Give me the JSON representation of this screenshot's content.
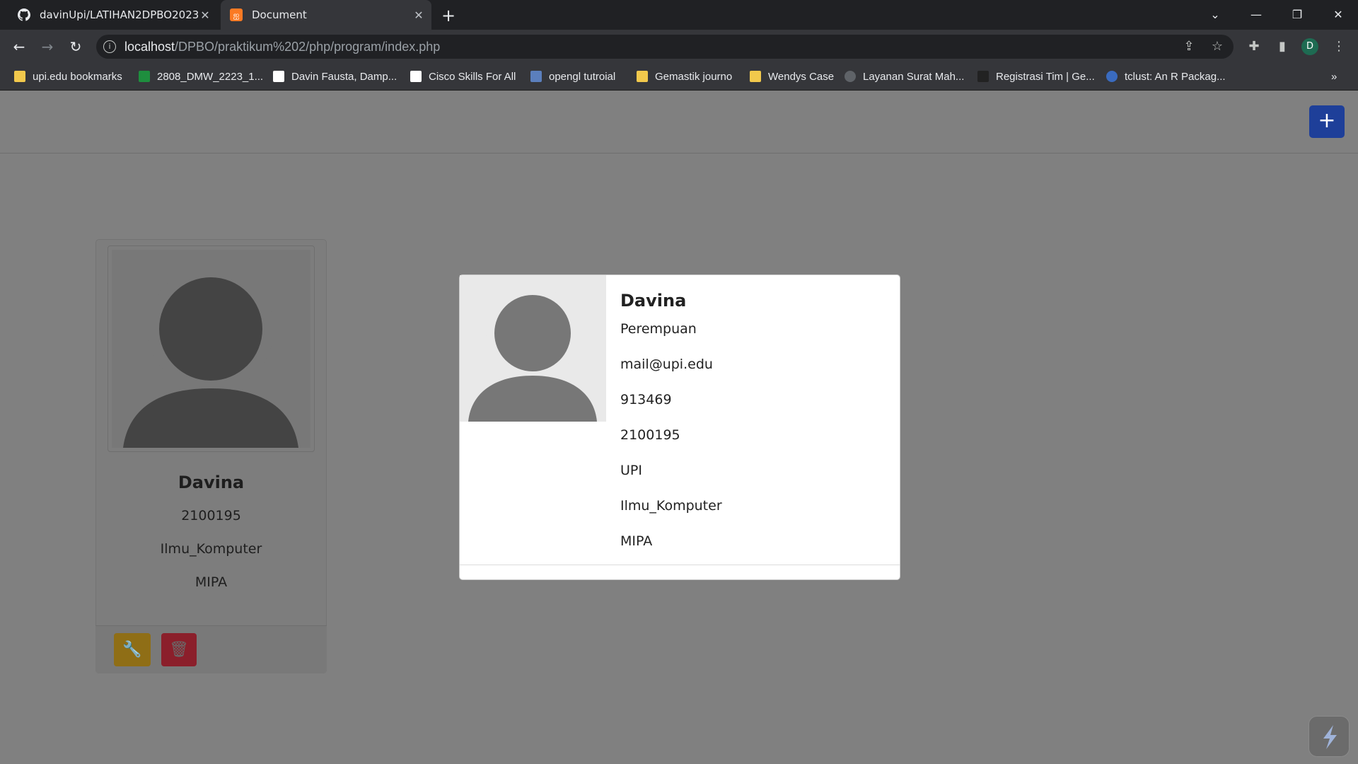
{
  "browser": {
    "tabs": [
      {
        "title": "davinUpi/LATIHAN2DPBO2023: \"",
        "active": false
      },
      {
        "title": "Document",
        "active": true
      }
    ],
    "new_tab_label": "+",
    "url_host": "localhost",
    "url_path": "/DPBO/praktikum%202/php/program/index.php",
    "profile_initial": "D",
    "bookmarks": [
      {
        "label": "upi.edu bookmarks",
        "icon": "folder-icon",
        "color": "#f2c94c"
      },
      {
        "label": "2808_DMW_2223_1...",
        "icon": "sheets-icon",
        "color": "#1e8e3e"
      },
      {
        "label": "Davin Fausta, Damp...",
        "icon": "pkp-icon",
        "color": "#ffffff"
      },
      {
        "label": "Cisco Skills For All",
        "icon": "cisco-icon",
        "color": "#ffffff"
      },
      {
        "label": "opengl tutroial",
        "icon": "opengl-icon",
        "color": "#5b7fbd"
      },
      {
        "label": "Gemastik journo",
        "icon": "folder-icon",
        "color": "#f2c94c"
      },
      {
        "label": "Wendys Case",
        "icon": "folder-icon",
        "color": "#f2c94c"
      },
      {
        "label": "Layanan Surat Mah...",
        "icon": "upi-icon",
        "color": "#5f6368"
      },
      {
        "label": "Registrasi Tim | Ge...",
        "icon": "gemastik-icon",
        "color": "#222222"
      },
      {
        "label": "tclust: An R Packag...",
        "icon": "r-icon",
        "color": "#3a6bbf"
      }
    ],
    "bookmarks_overflow": "»"
  },
  "page": {
    "add_button_label": "+",
    "card": {
      "name": "Davina",
      "nim": "2100195",
      "prodi": "Ilmu_Komputer",
      "fakultas": "MIPA"
    },
    "modal": {
      "name": "Davina",
      "gender": "Perempuan",
      "email": "mail@upi.edu",
      "phone": "913469",
      "nim": "2100195",
      "university": "UPI",
      "prodi": "Ilmu_Komputer",
      "fakultas": "MIPA"
    }
  },
  "colors": {
    "overlay": "#808080",
    "primary": "#1e3f99",
    "warning": "#8f6e16",
    "danger": "#8b1f2b"
  }
}
